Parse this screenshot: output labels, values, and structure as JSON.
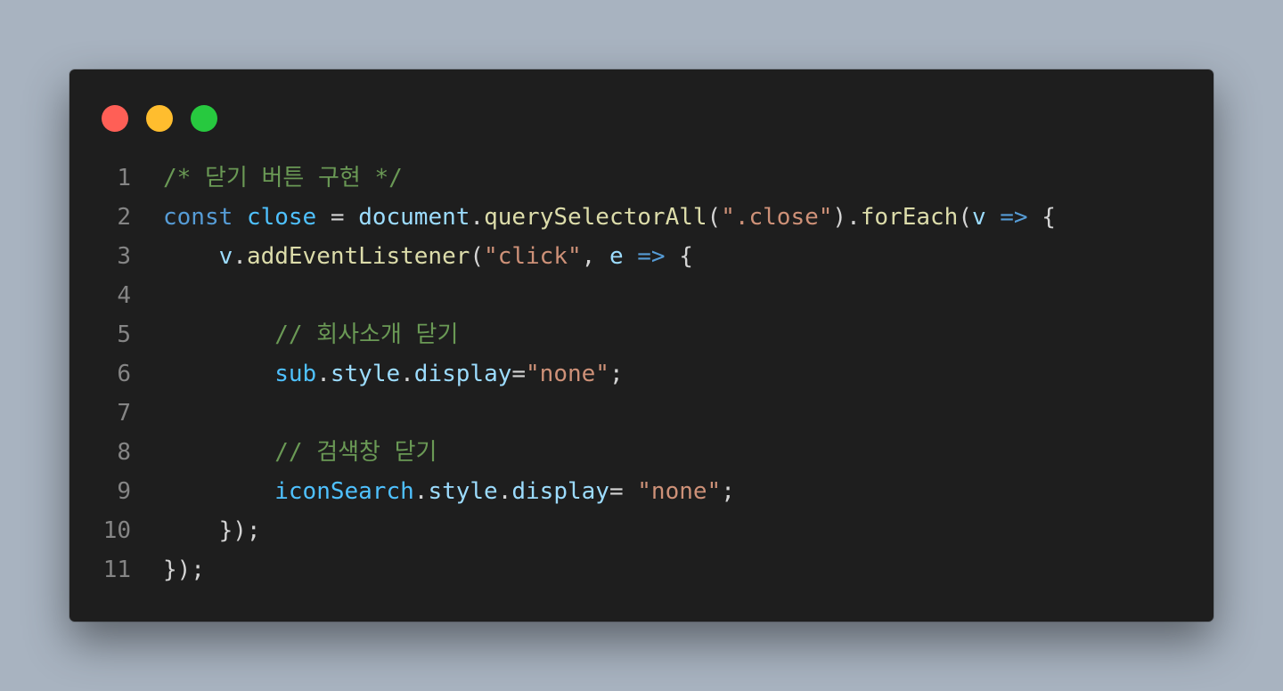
{
  "window": {
    "dots": [
      {
        "name": "close",
        "color": "#ff5f56"
      },
      {
        "name": "minimize",
        "color": "#ffbd2e"
      },
      {
        "name": "maximize",
        "color": "#27c93f"
      }
    ]
  },
  "code": {
    "lines": [
      {
        "number": "1",
        "tokens": [
          {
            "t": "/* 닫기 버튼 구현 */",
            "c": "com"
          }
        ]
      },
      {
        "number": "2",
        "tokens": [
          {
            "t": "const",
            "c": "kw"
          },
          {
            "t": " ",
            "c": "pun"
          },
          {
            "t": "close",
            "c": "const"
          },
          {
            "t": " = ",
            "c": "pun"
          },
          {
            "t": "document",
            "c": "var"
          },
          {
            "t": ".",
            "c": "pun"
          },
          {
            "t": "querySelectorAll",
            "c": "fn"
          },
          {
            "t": "(",
            "c": "pun"
          },
          {
            "t": "\".close\"",
            "c": "str"
          },
          {
            "t": ").",
            "c": "pun"
          },
          {
            "t": "forEach",
            "c": "fn"
          },
          {
            "t": "(",
            "c": "pun"
          },
          {
            "t": "v",
            "c": "var"
          },
          {
            "t": " ",
            "c": "pun"
          },
          {
            "t": "=>",
            "c": "kw"
          },
          {
            "t": " {",
            "c": "pun"
          }
        ]
      },
      {
        "number": "3",
        "tokens": [
          {
            "t": "    ",
            "c": "pun"
          },
          {
            "t": "v",
            "c": "var"
          },
          {
            "t": ".",
            "c": "pun"
          },
          {
            "t": "addEventListener",
            "c": "fn"
          },
          {
            "t": "(",
            "c": "pun"
          },
          {
            "t": "\"click\"",
            "c": "str"
          },
          {
            "t": ", ",
            "c": "pun"
          },
          {
            "t": "e",
            "c": "var"
          },
          {
            "t": " ",
            "c": "pun"
          },
          {
            "t": "=>",
            "c": "kw"
          },
          {
            "t": " {",
            "c": "pun"
          }
        ]
      },
      {
        "number": "4",
        "tokens": []
      },
      {
        "number": "5",
        "tokens": [
          {
            "t": "        ",
            "c": "pun"
          },
          {
            "t": "// 회사소개 닫기",
            "c": "com"
          }
        ]
      },
      {
        "number": "6",
        "tokens": [
          {
            "t": "        ",
            "c": "pun"
          },
          {
            "t": "sub",
            "c": "const"
          },
          {
            "t": ".",
            "c": "pun"
          },
          {
            "t": "style",
            "c": "var"
          },
          {
            "t": ".",
            "c": "pun"
          },
          {
            "t": "display",
            "c": "var"
          },
          {
            "t": "=",
            "c": "pun"
          },
          {
            "t": "\"none\"",
            "c": "str"
          },
          {
            "t": ";",
            "c": "pun"
          }
        ]
      },
      {
        "number": "7",
        "tokens": []
      },
      {
        "number": "8",
        "tokens": [
          {
            "t": "        ",
            "c": "pun"
          },
          {
            "t": "// 검색창 닫기",
            "c": "com"
          }
        ]
      },
      {
        "number": "9",
        "tokens": [
          {
            "t": "        ",
            "c": "pun"
          },
          {
            "t": "iconSearch",
            "c": "const"
          },
          {
            "t": ".",
            "c": "pun"
          },
          {
            "t": "style",
            "c": "var"
          },
          {
            "t": ".",
            "c": "pun"
          },
          {
            "t": "display",
            "c": "var"
          },
          {
            "t": "= ",
            "c": "pun"
          },
          {
            "t": "\"none\"",
            "c": "str"
          },
          {
            "t": ";",
            "c": "pun"
          }
        ]
      },
      {
        "number": "10",
        "tokens": [
          {
            "t": "    ",
            "c": "pun"
          },
          {
            "t": "});",
            "c": "pun"
          }
        ]
      },
      {
        "number": "11",
        "tokens": [
          {
            "t": "});",
            "c": "pun"
          }
        ]
      }
    ]
  }
}
